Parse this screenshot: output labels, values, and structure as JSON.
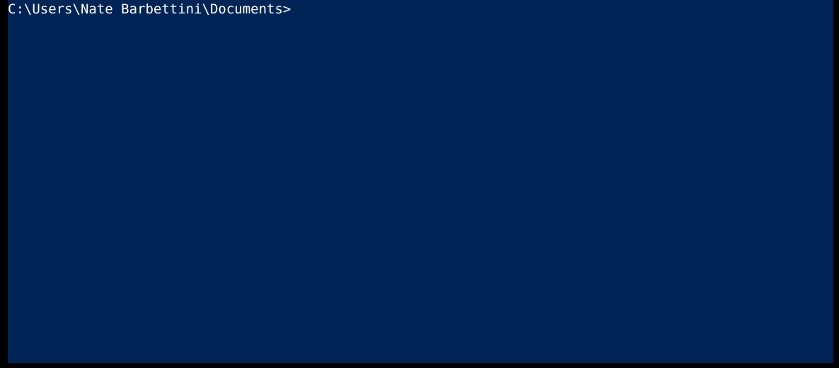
{
  "terminal": {
    "prompt": "C:\\Users\\Nate Barbettini\\Documents>",
    "command_value": ""
  }
}
